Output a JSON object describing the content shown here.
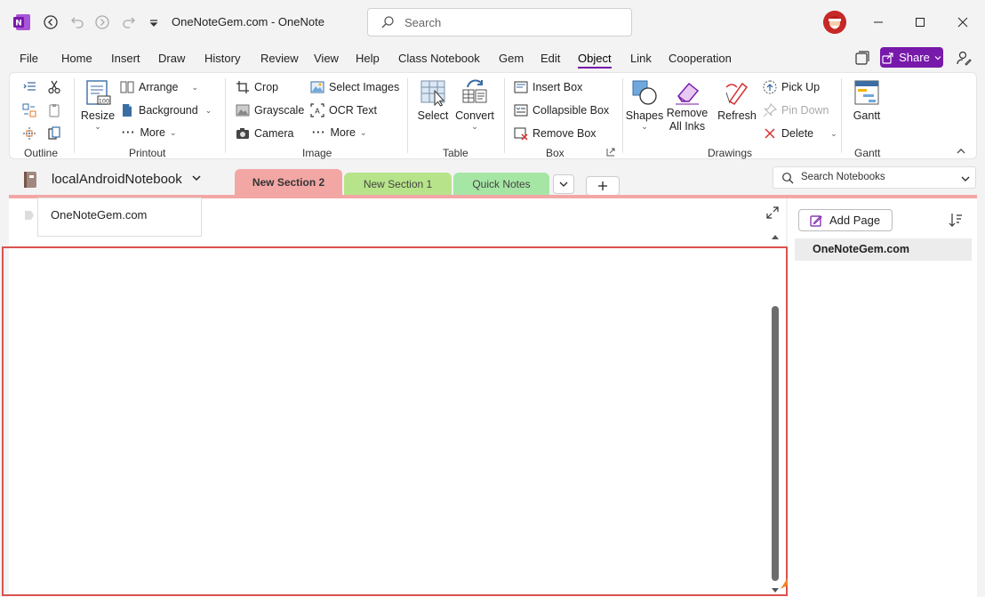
{
  "title_bar": {
    "window_title": "OneNoteGem.com  -  OneNote",
    "search_placeholder": "Search"
  },
  "menu": {
    "items": [
      "File",
      "Home",
      "Insert",
      "Draw",
      "History",
      "Review",
      "View",
      "Help",
      "Class Notebook",
      "Gem",
      "Edit",
      "Object",
      "Link",
      "Cooperation"
    ],
    "active": "Object",
    "share_label": "Share"
  },
  "ribbon": {
    "groups": {
      "outline": "Outline",
      "printout": "Printout",
      "image": "Image",
      "table": "Table",
      "box": "Box",
      "drawings": "Drawings",
      "gantt": "Gantt"
    },
    "printout": {
      "resize": "Resize",
      "arrange": "Arrange",
      "background": "Background",
      "more": "More"
    },
    "image": {
      "crop": "Crop",
      "grayscale": "Grayscale",
      "camera": "Camera",
      "select_images": "Select Images",
      "ocr_text": "OCR Text",
      "more": "More"
    },
    "table": {
      "select": "Select",
      "convert": "Convert"
    },
    "box": {
      "insert_box": "Insert Box",
      "collapsible_box": "Collapsible Box",
      "remove_box": "Remove Box"
    },
    "drawings": {
      "shapes": "Shapes",
      "remove_all_inks_1": "Remove",
      "remove_all_inks_2": "All Inks",
      "refresh": "Refresh",
      "pick_up": "Pick Up",
      "pin_down": "Pin Down",
      "delete": "Delete"
    },
    "gantt": {
      "gantt": "Gantt"
    }
  },
  "notebook": {
    "name": "localAndroidNotebook",
    "sections": [
      {
        "label": "New Section 2",
        "color": "#f2a7a5"
      },
      {
        "label": "New Section 1",
        "color": "#b7e48a"
      },
      {
        "label": "Quick Notes",
        "color": "#a6e6a4"
      }
    ],
    "search_placeholder": "Search Notebooks"
  },
  "page": {
    "title": "OneNoteGem.com"
  },
  "pages_pane": {
    "add_page": "Add Page",
    "pages": [
      "OneNoteGem.com"
    ]
  },
  "colors": {
    "accent": "#7719aa",
    "annotation_red": "#d9534f",
    "annotation_arrow": "#f58220"
  }
}
